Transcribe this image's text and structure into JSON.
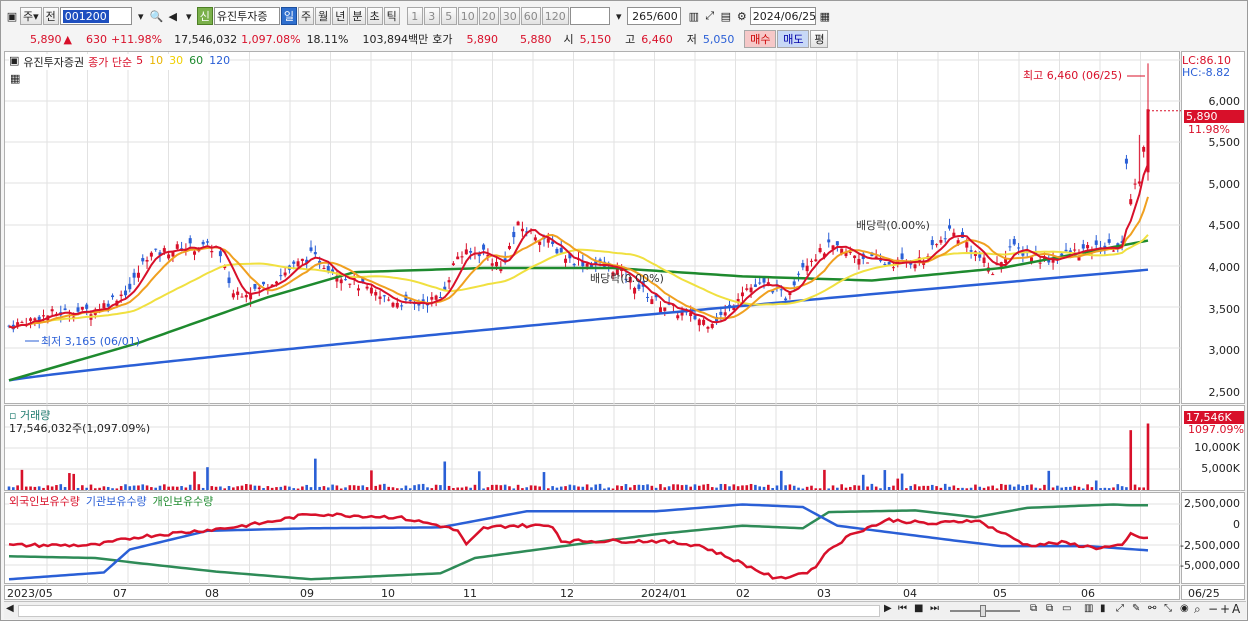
{
  "toolbar": {
    "mode": "주",
    "prev": "전",
    "code": "001200",
    "name": "유진투자증",
    "credit": "신",
    "periods": [
      "일",
      "주",
      "월",
      "년",
      "분",
      "초",
      "틱"
    ],
    "active_period": "일",
    "minutes": [
      "1",
      "3",
      "5",
      "10",
      "20",
      "30",
      "60",
      "120"
    ],
    "count": "265",
    "count_total": "/600",
    "date": "2024/06/25"
  },
  "quote": {
    "price": "5,890",
    "change": "630",
    "pct": "+11.98%",
    "volume": "17,546,032",
    "vol_pct": "1,097.08%",
    "turnover": "18.11%",
    "amount": "103,894백만",
    "hoga_label": "호가",
    "ask": "5,890",
    "bid": "5,880",
    "open_label": "시",
    "open": "5,150",
    "high_label": "고",
    "high": "6,460",
    "low_label": "저",
    "low": "5,050",
    "buy": "매수",
    "sell": "매도",
    "avg": "평"
  },
  "price_panel": {
    "title": "유진투자증권",
    "ma_label": "종가 단순",
    "ma": [
      {
        "p": "5",
        "c": "#d8102a"
      },
      {
        "p": "10",
        "c": "#e8b400"
      },
      {
        "p": "30",
        "c": "#f0d000"
      },
      {
        "p": "60",
        "c": "#1e8a2e"
      },
      {
        "p": "120",
        "c": "#2a5fd6"
      }
    ],
    "lc": "LC:86.10",
    "hc": "HC:-8.82",
    "max_note": "최고 6,460 (06/25)",
    "min_note": "최저 3,165 (06/01)",
    "div1": "배당락(0.00%)",
    "div2": "배당락(0.00%)",
    "cur_price": "5,890",
    "cur_pct": "11.98%",
    "y_ticks": [
      "6,000",
      "5,500",
      "5,000",
      "4,500",
      "4,000",
      "3,500",
      "3,000",
      "2,500"
    ]
  },
  "volume_panel": {
    "title": "거래량",
    "value": "17,546,032주(1,097.09%)",
    "cur": "17,546K",
    "cur_pct": "1097.09%",
    "y_ticks": [
      "10,000K",
      "5,000K"
    ]
  },
  "holding_panel": {
    "legend": [
      {
        "name": "외국인보유수량",
        "c": "#d8102a"
      },
      {
        "name": "기관보유수량",
        "c": "#2a5fd6"
      },
      {
        "name": "개인보유수량",
        "c": "#1e8a2e"
      }
    ],
    "y_ticks": [
      "2,500,000",
      "0",
      "-2,500,000",
      "-5,000,000"
    ]
  },
  "x_axis": [
    "2023/05",
    "07",
    "08",
    "09",
    "10",
    "11",
    "12",
    "2024/01",
    "02",
    "03",
    "04",
    "05",
    "06"
  ],
  "x_cur": "06/25",
  "colors": {
    "up": "#d8102a",
    "down": "#2a5fd6",
    "ma60": "#1e8a2e",
    "ma10": "#e8b400",
    "ma30": "#f0d000"
  },
  "chart_data": {
    "type": "line",
    "title": "유진투자증권",
    "series": [
      {
        "name": "5",
        "values": []
      },
      {
        "name": "10",
        "values": []
      },
      {
        "name": "30",
        "values": []
      },
      {
        "name": "60",
        "values": []
      },
      {
        "name": "120",
        "values": []
      }
    ],
    "ylim": [
      2450,
      6500
    ],
    "high": 6460,
    "low": 3165,
    "close": 5890
  }
}
